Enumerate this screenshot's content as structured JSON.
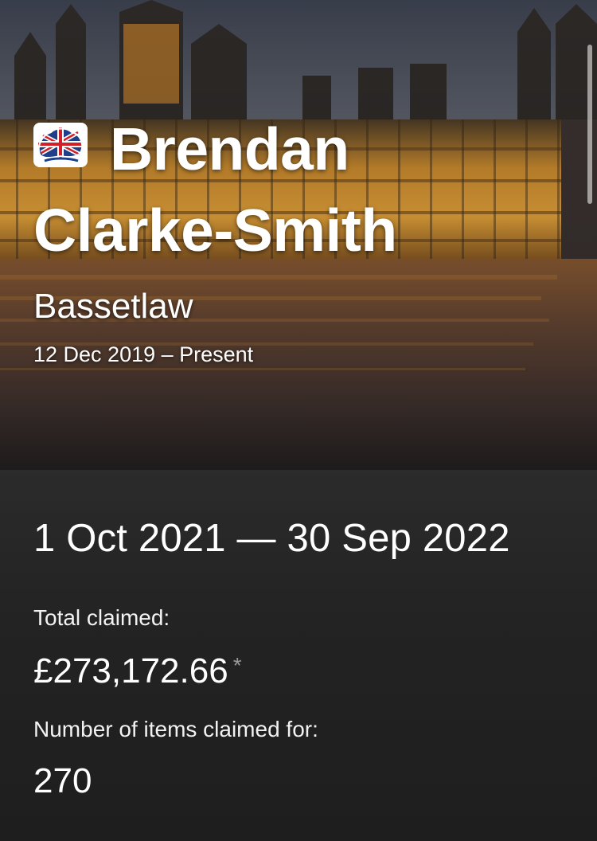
{
  "mp": {
    "first_name": "Brendan",
    "last_name": "Clarke-Smith",
    "constituency": "Bassetlaw",
    "term": "12 Dec 2019 – Present",
    "party_logo_icon": "conservative-union-flag-tree-icon"
  },
  "expenses": {
    "period": "1 Oct 2021 — 30 Sep 2022",
    "total_label": "Total claimed:",
    "total_value": "£273,172.66",
    "total_footnote_mark": "*",
    "items_label": "Number of items claimed for:",
    "items_value": "270"
  },
  "colors": {
    "details_background": "#1f1f1f",
    "text": "#ffffff",
    "footnote": "#9a9a9a"
  }
}
